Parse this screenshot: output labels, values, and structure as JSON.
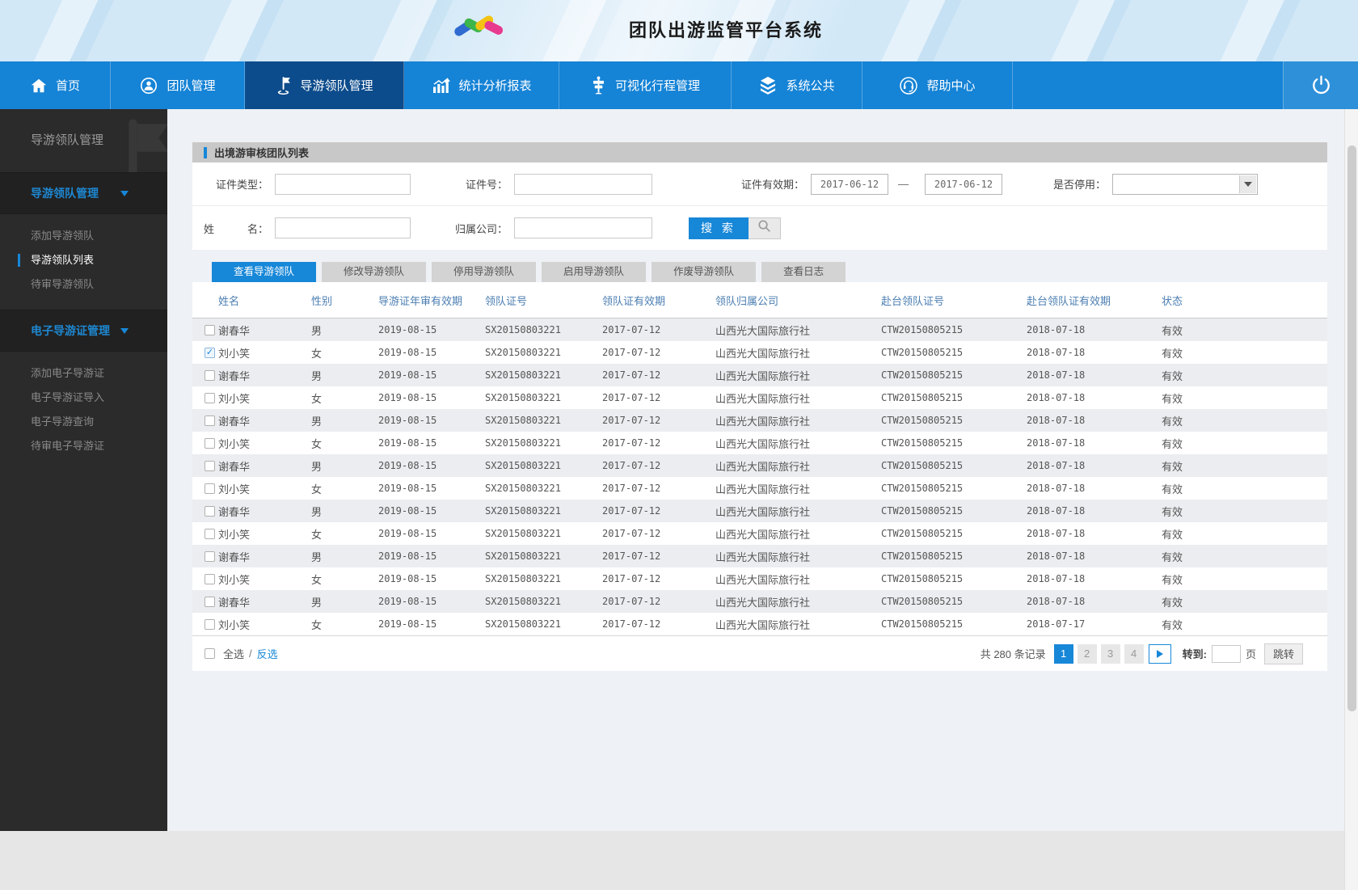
{
  "app": {
    "title": "团队出游监管平台系统"
  },
  "nav": {
    "items": [
      {
        "label": "首页",
        "icon": "home-icon",
        "active": false
      },
      {
        "label": "团队管理",
        "icon": "team-icon",
        "active": false
      },
      {
        "label": "导游领队管理",
        "icon": "guide-flag-icon",
        "active": true
      },
      {
        "label": "统计分析报表",
        "icon": "stats-icon",
        "active": false
      },
      {
        "label": "可视化行程管理",
        "icon": "itinerary-icon",
        "active": false
      },
      {
        "label": "系统公共",
        "icon": "layers-icon",
        "active": false
      },
      {
        "label": "帮助中心",
        "icon": "headset-icon",
        "active": false
      }
    ],
    "logout_icon": "power-icon"
  },
  "sidebar": {
    "title": "导游领队管理",
    "watermark_icon": "flag-icon",
    "sections": [
      {
        "label": "导游领队管理",
        "items": [
          {
            "label": "添加导游领队",
            "active": false
          },
          {
            "label": "导游领队列表",
            "active": true
          },
          {
            "label": "待审导游领队",
            "active": false
          }
        ]
      },
      {
        "label": "电子导游证管理",
        "items": [
          {
            "label": "添加电子导游证",
            "active": false
          },
          {
            "label": "电子导游证导入",
            "active": false
          },
          {
            "label": "电子导游查询",
            "active": false
          },
          {
            "label": "待审电子导游证",
            "active": false
          }
        ]
      }
    ]
  },
  "panel": {
    "title": "出境游审核团队列表",
    "search": {
      "cert_type_label": "证件类型：",
      "cert_no_label": "证件号：",
      "validity_label": "证件有效期：",
      "validity_from": "2017-06-12",
      "validity_dash": "—",
      "validity_to": "2017-06-12",
      "disabled_label": "是否停用：",
      "name_label": {
        "first": "姓",
        "last": "名："
      },
      "company_label": "归属公司：",
      "search_button": "搜 索"
    },
    "tabs": [
      {
        "label": "查看导游领队",
        "active": true
      },
      {
        "label": "修改导游领队",
        "active": false
      },
      {
        "label": "停用导游领队",
        "active": false
      },
      {
        "label": "启用导游领队",
        "active": false
      },
      {
        "label": "作废导游领队",
        "active": false
      },
      {
        "label": "查看日志",
        "active": false
      }
    ],
    "table": {
      "columns": [
        "姓名",
        "性别",
        "导游证年审有效期",
        "领队证号",
        "领队证有效期",
        "领队归属公司",
        "赴台领队证号",
        "赴台领队证有效期",
        "状态"
      ],
      "rows": [
        {
          "checked": false,
          "name": "谢春华",
          "gender": "男",
          "annual_valid": "2019-08-15",
          "leader_cert_no": "SX20150803221",
          "cert_valid": "2017-07-12",
          "company": "山西光大国际旅行社",
          "tw_cert_no": "CTW20150805215",
          "tw_valid": "2018-07-18",
          "status": "有效"
        },
        {
          "checked": true,
          "name": "刘小笑",
          "gender": "女",
          "annual_valid": "2019-08-15",
          "leader_cert_no": "SX20150803221",
          "cert_valid": "2017-07-12",
          "company": "山西光大国际旅行社",
          "tw_cert_no": "CTW20150805215",
          "tw_valid": "2018-07-18",
          "status": "有效"
        },
        {
          "checked": false,
          "name": "谢春华",
          "gender": "男",
          "annual_valid": "2019-08-15",
          "leader_cert_no": "SX20150803221",
          "cert_valid": "2017-07-12",
          "company": "山西光大国际旅行社",
          "tw_cert_no": "CTW20150805215",
          "tw_valid": "2018-07-18",
          "status": "有效"
        },
        {
          "checked": false,
          "name": "刘小笑",
          "gender": "女",
          "annual_valid": "2019-08-15",
          "leader_cert_no": "SX20150803221",
          "cert_valid": "2017-07-12",
          "company": "山西光大国际旅行社",
          "tw_cert_no": "CTW20150805215",
          "tw_valid": "2018-07-18",
          "status": "有效"
        },
        {
          "checked": false,
          "name": "谢春华",
          "gender": "男",
          "annual_valid": "2019-08-15",
          "leader_cert_no": "SX20150803221",
          "cert_valid": "2017-07-12",
          "company": "山西光大国际旅行社",
          "tw_cert_no": "CTW20150805215",
          "tw_valid": "2018-07-18",
          "status": "有效"
        },
        {
          "checked": false,
          "name": "刘小笑",
          "gender": "女",
          "annual_valid": "2019-08-15",
          "leader_cert_no": "SX20150803221",
          "cert_valid": "2017-07-12",
          "company": "山西光大国际旅行社",
          "tw_cert_no": "CTW20150805215",
          "tw_valid": "2018-07-18",
          "status": "有效"
        },
        {
          "checked": false,
          "name": "谢春华",
          "gender": "男",
          "annual_valid": "2019-08-15",
          "leader_cert_no": "SX20150803221",
          "cert_valid": "2017-07-12",
          "company": "山西光大国际旅行社",
          "tw_cert_no": "CTW20150805215",
          "tw_valid": "2018-07-18",
          "status": "有效"
        },
        {
          "checked": false,
          "name": "刘小笑",
          "gender": "女",
          "annual_valid": "2019-08-15",
          "leader_cert_no": "SX20150803221",
          "cert_valid": "2017-07-12",
          "company": "山西光大国际旅行社",
          "tw_cert_no": "CTW20150805215",
          "tw_valid": "2018-07-18",
          "status": "有效"
        },
        {
          "checked": false,
          "name": "谢春华",
          "gender": "男",
          "annual_valid": "2019-08-15",
          "leader_cert_no": "SX20150803221",
          "cert_valid": "2017-07-12",
          "company": "山西光大国际旅行社",
          "tw_cert_no": "CTW20150805215",
          "tw_valid": "2018-07-18",
          "status": "有效"
        },
        {
          "checked": false,
          "name": "刘小笑",
          "gender": "女",
          "annual_valid": "2019-08-15",
          "leader_cert_no": "SX20150803221",
          "cert_valid": "2017-07-12",
          "company": "山西光大国际旅行社",
          "tw_cert_no": "CTW20150805215",
          "tw_valid": "2018-07-18",
          "status": "有效"
        },
        {
          "checked": false,
          "name": "谢春华",
          "gender": "男",
          "annual_valid": "2019-08-15",
          "leader_cert_no": "SX20150803221",
          "cert_valid": "2017-07-12",
          "company": "山西光大国际旅行社",
          "tw_cert_no": "CTW20150805215",
          "tw_valid": "2018-07-18",
          "status": "有效"
        },
        {
          "checked": false,
          "name": "刘小笑",
          "gender": "女",
          "annual_valid": "2019-08-15",
          "leader_cert_no": "SX20150803221",
          "cert_valid": "2017-07-12",
          "company": "山西光大国际旅行社",
          "tw_cert_no": "CTW20150805215",
          "tw_valid": "2018-07-18",
          "status": "有效"
        },
        {
          "checked": false,
          "name": "谢春华",
          "gender": "男",
          "annual_valid": "2019-08-15",
          "leader_cert_no": "SX20150803221",
          "cert_valid": "2017-07-12",
          "company": "山西光大国际旅行社",
          "tw_cert_no": "CTW20150805215",
          "tw_valid": "2018-07-18",
          "status": "有效"
        },
        {
          "checked": false,
          "name": "刘小笑",
          "gender": "女",
          "annual_valid": "2019-08-15",
          "leader_cert_no": "SX20150803221",
          "cert_valid": "2017-07-12",
          "company": "山西光大国际旅行社",
          "tw_cert_no": "CTW20150805215",
          "tw_valid": "2018-07-17",
          "status": "有效"
        }
      ]
    },
    "footer": {
      "select_all_label": "全选",
      "divider": "/",
      "invert_label": "反选",
      "total_text": "共 280 条记录",
      "pages": [
        "1",
        "2",
        "3",
        "4"
      ],
      "active_page": "1",
      "goto_label": "转到:",
      "page_unit": "页",
      "jump_label": "跳转"
    }
  },
  "colors": {
    "nav_blue": "#1583d6",
    "nav_active_blue": "#0d4c8c",
    "accent_blue": "#1787d8",
    "sidebar_bg": "#2b2b2b",
    "panel_header_gray": "#c8c8c8",
    "row_alt_gray": "#ebedf0",
    "table_header_text": "#4b7eb2"
  }
}
